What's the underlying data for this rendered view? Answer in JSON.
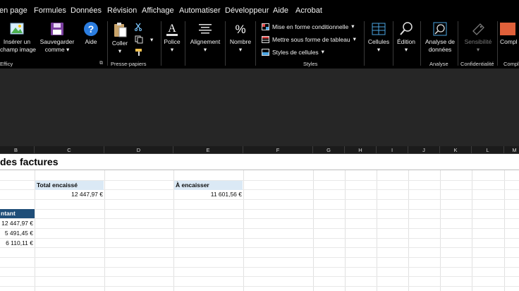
{
  "menu": [
    "en page",
    "Formules",
    "Données",
    "Révision",
    "Affichage",
    "Automatiser",
    "Développeur",
    "Aide",
    "Acrobat"
  ],
  "ribbon": {
    "efficy": {
      "insert_label_1": "Insérer un",
      "insert_label_2": "champ image",
      "save_label_1": "Sauvegarder",
      "save_label_2": "comme",
      "help_label": "Aide",
      "group_label": "Efficy"
    },
    "clipboard": {
      "paste_label": "Coller",
      "group_label": "Presse-papiers"
    },
    "font": {
      "label": "Police"
    },
    "alignment": {
      "label": "Alignement"
    },
    "number": {
      "label": "Nombre"
    },
    "styles": {
      "conditional": "Mise en forme conditionnelle",
      "table": "Mettre sous forme de tableau",
      "cell_styles": "Styles de cellules",
      "group_label": "Styles"
    },
    "cells": {
      "label": "Cellules"
    },
    "editing": {
      "label": "Édition"
    },
    "analysis": {
      "label_1": "Analyse de",
      "label_2": "données",
      "group_label": "Analyse"
    },
    "sensitivity": {
      "label": "Sensibilité",
      "group_label": "Confidentialité"
    },
    "compliance": {
      "label": "Compl",
      "group_label": "Compl"
    }
  },
  "columns": [
    "B",
    "C",
    "D",
    "E",
    "F",
    "G",
    "H",
    "I",
    "J",
    "K",
    "L",
    "M"
  ],
  "sheet": {
    "title": "des factures",
    "total_encaisse_label": "Total encaissé",
    "total_encaisse_value": "12 447,97 €",
    "a_encaisser_label": "À encaisser",
    "a_encaisser_value": "11 601,56 €",
    "table_header": "ntant",
    "amounts": [
      "12 447,97 €",
      "5 491,45 €",
      "6 110,11 €"
    ]
  },
  "colors": {
    "menubar": "#000000",
    "ribbon": "#000000",
    "dark_area": "#262626",
    "header_fill": "#dbe9f5",
    "table_header_fill": "#1f4e79"
  }
}
